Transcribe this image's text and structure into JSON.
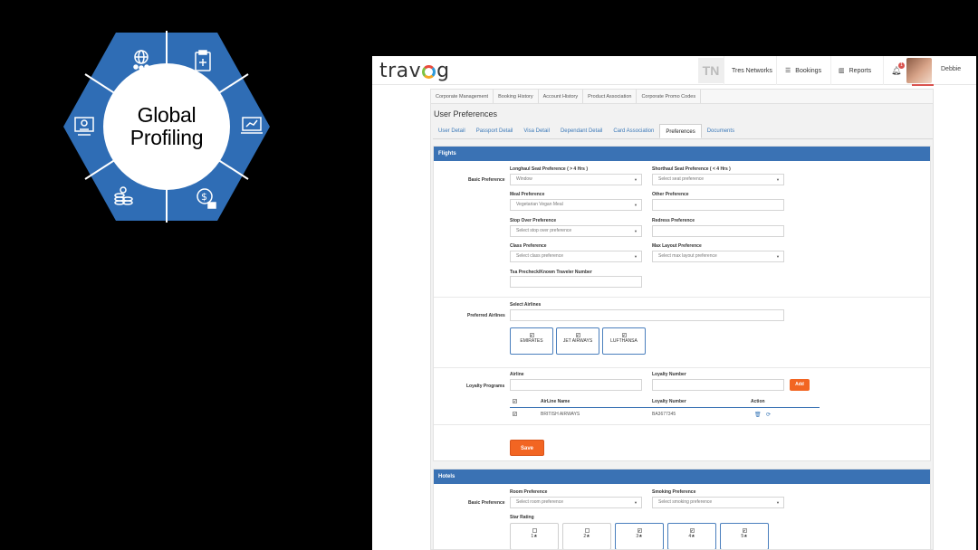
{
  "hexagon": {
    "title_line1": "Global",
    "title_line2": "Profiling",
    "color": "#2f6db5",
    "segment_icons": [
      "globe-people-icon",
      "medical-clipboard-icon",
      "laptop-chart-icon",
      "dollar-hand-icon",
      "coin-stacks-icon",
      "monitor-presentation-icon"
    ]
  },
  "app": {
    "logo": {
      "before": "trav",
      "after": "g"
    },
    "tn_badge": "TN",
    "nav": {
      "company": "Tres Networks",
      "bookings": "Bookings",
      "reports": "Reports",
      "notifications": "1",
      "user": "Debbie"
    },
    "subtabs": [
      "Corporate Management",
      "Booking History",
      "Account History",
      "Product Association",
      "Corporate Promo Codes"
    ],
    "page_title": "User Preferences",
    "tabs": [
      "User Detail",
      "Passport Detail",
      "Visa Detail",
      "Dependant Detail",
      "Card Association",
      "Preferences",
      "Documents"
    ],
    "active_tab": "Preferences",
    "flights": {
      "header": "Flights",
      "basic_label": "Basic Preference",
      "longhaul_label": "Longhaul Seat Preference ( > 4 Hrs )",
      "longhaul_value": "Window",
      "shorthaul_label": "Shorthaul Seat Preference ( < 4 Hrs )",
      "shorthaul_value": "Select seat preference",
      "meal_label": "Meal Preference",
      "meal_value": "Vegetarian Vegan Meal",
      "other_label": "Other Preference",
      "stopover_label": "Stop Over Preference",
      "stopover_value": "Select stop over preference",
      "redress_label": "Redress Preference",
      "class_label": "Class Preference",
      "class_value": "Select class preference",
      "maxlayout_label": "Max Layout Preference",
      "maxlayout_value": "Select max layout preference",
      "tsa_label": "Tsa Precheck/Known Traveler Number",
      "preferred_airlines_label": "Preferred Airlines",
      "select_airlines_label": "Select Airlines",
      "airlines": [
        "EMIRATES",
        "JET AIRWAYS",
        "LUFTHANSA"
      ],
      "loyalty_label": "Loyalty Programs",
      "airline_field_label": "Airline",
      "loyalty_number_label": "Loyalty Number",
      "add_label": "Add",
      "table_headers": [
        "AirLine Name",
        "Loyalty Number",
        "Action"
      ],
      "rows": [
        {
          "airline": "BRITISH AIRWAYS",
          "number": "BA3677345"
        }
      ],
      "save_label": "Save"
    },
    "hotels": {
      "header": "Hotels",
      "basic_label": "Basic Preference",
      "room_label": "Room Preference",
      "room_value": "Select room preference",
      "smoking_label": "Smoking Preference",
      "smoking_value": "Select smoking preference",
      "star_label": "Star Rating",
      "stars": [
        "1★",
        "2★",
        "3★",
        "4★",
        "5★"
      ]
    },
    "accent": "#3a72b4",
    "button_color": "#f26522"
  }
}
